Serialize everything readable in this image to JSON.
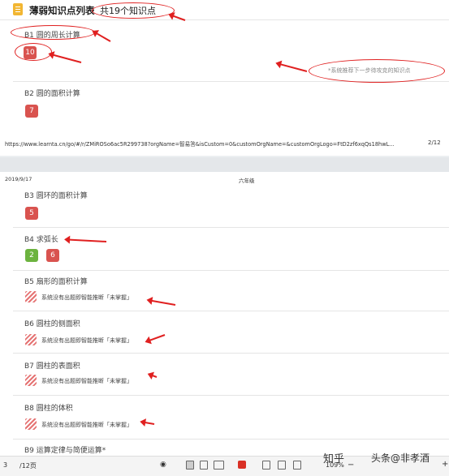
{
  "page1": {
    "title": "薄弱知识点列表",
    "count": "共19个知识点",
    "sections": [
      {
        "title": "B1 圆的周长计算",
        "badges": [
          "10"
        ]
      },
      {
        "title": "B2 圆的面积计算",
        "badges": [
          "7"
        ]
      }
    ],
    "hint": "*系统推荐下一步待攻克的知识点",
    "url": "https://www.learnta.cn/go/#/r/ZMiROSo6ac5R299738?orgName=智易答&isCustom=0&customOrgName=&customOrgLogo=FtD2zf6xqQs18hwL...",
    "page_number": "2/12"
  },
  "page2": {
    "date": "2019/9/17",
    "grade": "六年级",
    "sections": [
      {
        "title": "B3 圆环的面积计算",
        "badges": [
          "5"
        ]
      },
      {
        "title": "B4 求弧长",
        "badges": [
          "2",
          "6"
        ]
      },
      {
        "title": "B5 扇形的面积计算",
        "nodata": "系统没有出题即智能推断「未掌握」"
      },
      {
        "title": "B6 圆柱的侧面积",
        "nodata": "系统没有出题即智能推断「未掌握」"
      },
      {
        "title": "B7 圆柱的表面积",
        "nodata": "系统没有出题即智能推断「未掌握」"
      },
      {
        "title": "B8 圆柱的体积",
        "nodata": "系统没有出题即智能推断「未掌握」"
      },
      {
        "title": "B9 运算定律与简便运算*"
      }
    ]
  },
  "toolbar": {
    "current_page": "3",
    "total_pages": "/12页",
    "zoom": "109%"
  },
  "watermark": "头条@非孝酒",
  "watermark_brand": "知乎"
}
